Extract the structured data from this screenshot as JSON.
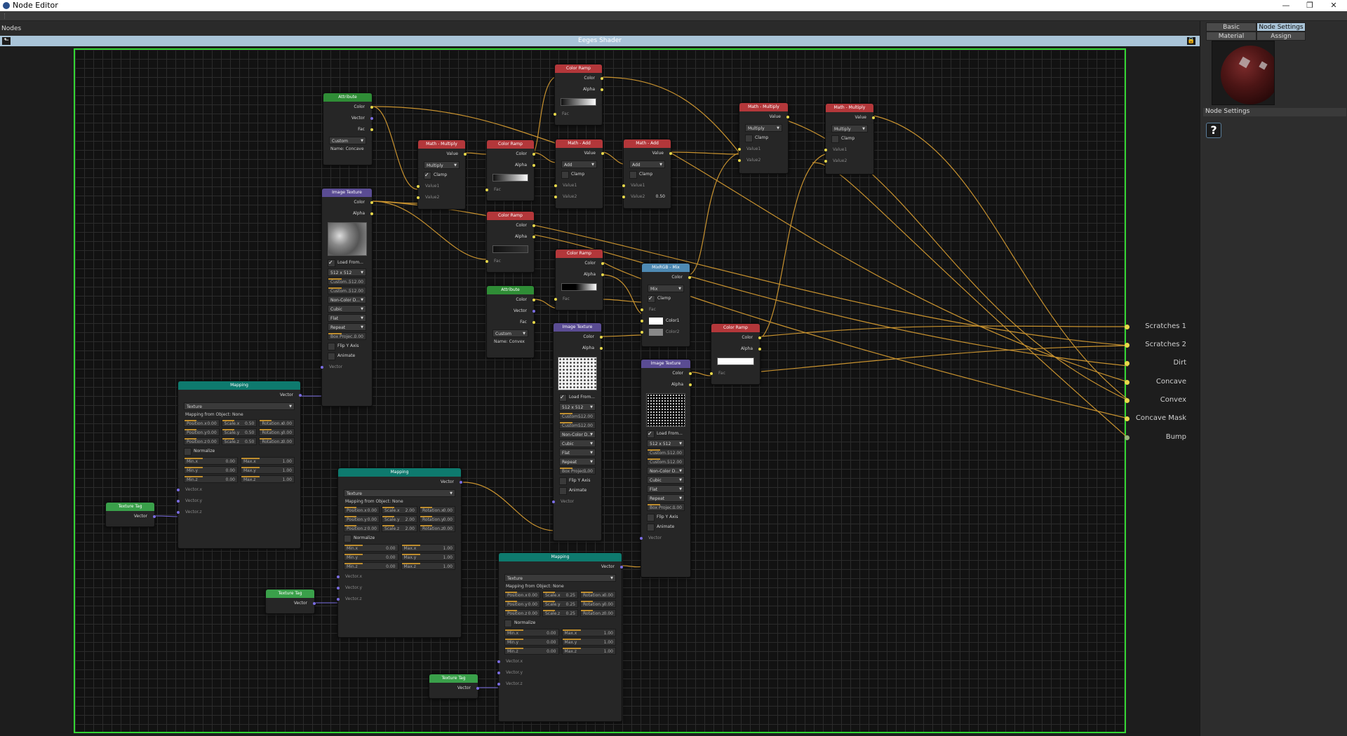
{
  "window": {
    "title": "Node Editor",
    "minimize": "—",
    "restore": "❐",
    "close": "✕"
  },
  "canvas": {
    "label": "Nodes",
    "shader_title": "Eeges Shader"
  },
  "colors": {
    "attribute": "#2f8d36",
    "color_ramp": "#b3373a",
    "math": "#b3373a",
    "image_texture": "#5a4c93",
    "mapping": "#0e7a6e",
    "texture_tag": "#3aa04a",
    "mix": "#4e8ab3",
    "output_dot": "#e7d84a",
    "wire": "#c8922f",
    "canvas_border": "#33d633"
  },
  "nodes": {
    "attr1": {
      "title": "Attribute",
      "ports": [
        "Color",
        "Vector",
        "Fac"
      ],
      "mode": "Custom",
      "name": "Name: Concave"
    },
    "attr2": {
      "title": "Attribute",
      "ports": [
        "Color",
        "Vector",
        "Fac"
      ],
      "mode": "Custom",
      "name": "Name: Convex"
    },
    "img1": {
      "title": "Image Texture",
      "color": "Color",
      "alpha": "Alpha",
      "load": "Load From...",
      "res": "512 x 512",
      "cw": "Custom...",
      "cw_v": "512.00",
      "ch": "Custom...",
      "ch_v": "512.00",
      "cs": "Non-Color D...",
      "interp": "Cubic",
      "proj": "Flat",
      "ext": "Repeat",
      "box": "Box Projec...",
      "box_v": "0.00",
      "flip": "Flip Y Axis",
      "anim": "Animate",
      "vec": "Vector"
    },
    "ramp_top": {
      "title": "Color Ramp",
      "color": "Color",
      "alpha": "Alpha",
      "fac": "Fac"
    },
    "ramp_a": {
      "title": "Color Ramp",
      "color": "Color",
      "alpha": "Alpha",
      "fac": "Fac"
    },
    "ramp_b": {
      "title": "Color Ramp",
      "color": "Color",
      "alpha": "Alpha",
      "fac": "Fac"
    },
    "ramp_c": {
      "title": "Color Ramp",
      "color": "Color",
      "alpha": "Alpha",
      "fac": "Fac"
    },
    "ramp_d": {
      "title": "Color Ramp",
      "color": "Color",
      "alpha": "Alpha",
      "fac": "Fac"
    },
    "mult1": {
      "title": "Math - Multiply",
      "value": "Value",
      "mode": "Multiply",
      "clamp": "Clamp",
      "v1": "Value1",
      "v2": "Value2"
    },
    "add1": {
      "title": "Math - Add",
      "value": "Value",
      "mode": "Add",
      "clamp": "Clamp",
      "v1": "Value1",
      "v2": "Value2"
    },
    "add2": {
      "title": "Math - Add",
      "value": "Value",
      "mode": "Add",
      "clamp": "Clamp",
      "v1": "Value1",
      "v2": "Value2",
      "v2_val": "0.50"
    },
    "mult2": {
      "title": "Math - Multiply",
      "value": "Value",
      "mode": "Multiply",
      "clamp": "Clamp",
      "v1": "Value1",
      "v2": "Value2"
    },
    "mult3": {
      "title": "Math - Multiply",
      "value": "Value",
      "mode": "Multiply",
      "clamp": "Clamp",
      "v1": "Value1",
      "v2": "Value2"
    },
    "mix": {
      "title": "MixRGB - Mix",
      "color": "Color",
      "mode": "Mix",
      "clamp": "Clamp",
      "fac": "Fac",
      "c1": "Color1",
      "c2": "Color2"
    },
    "img2": {
      "title": "Image Texture",
      "color": "Color",
      "alpha": "Alpha",
      "load": "Load From...",
      "res": "512 x 512",
      "cw": "Custom...",
      "cw_v": "512.00",
      "ch": "Custom...",
      "ch_v": "512.00",
      "cs": "Non-Color D...",
      "interp": "Cubic",
      "proj": "Flat",
      "ext": "Repeat",
      "box": "Box Projec...",
      "box_v": "0.00",
      "flip": "Flip Y Axis",
      "anim": "Animate",
      "vec": "Vector"
    },
    "img3": {
      "title": "Image Texture",
      "color": "Color",
      "alpha": "Alpha",
      "load": "Load From...",
      "res": "512 x 512",
      "cw": "Custom...",
      "cw_v": "512.00",
      "ch": "Custom...",
      "ch_v": "512.00",
      "cs": "Non-Color D...",
      "interp": "Cubic",
      "proj": "Flat",
      "ext": "Repeat",
      "box": "Box Projec...",
      "box_v": "0.00",
      "flip": "Flip Y Axis",
      "anim": "Animate",
      "vec": "Vector"
    },
    "map1": {
      "title": "Mapping",
      "vector": "Vector",
      "mode": "Texture",
      "from": "Mapping from Object: None",
      "px": "Position.x",
      "py": "Position.y",
      "pz": "Position.z",
      "sx": "Scale.x",
      "sy": "Scale.y",
      "sz": "Scale.z",
      "rx": "Rotation.x",
      "ry": "Rotation.y",
      "rz": "Rotation.z",
      "pv": "0.00",
      "sv": "0.50",
      "rv": "0.00",
      "norm": "Normalize",
      "minx": "Min.x",
      "miny": "Min.y",
      "minz": "Min.z",
      "maxx": "Max.x",
      "maxy": "Max.y",
      "maxz": "Max.z",
      "minv": "0.00",
      "maxv": "1.00",
      "vx": "Vector.x",
      "vy": "Vector.y",
      "vz": "Vector.z"
    },
    "map2": {
      "title": "Mapping",
      "vector": "Vector",
      "mode": "Texture",
      "from": "Mapping from Object: None",
      "px": "Position.x",
      "py": "Position.y",
      "pz": "Position.z",
      "sx": "Scale.x",
      "sy": "Scale.y",
      "sz": "Scale.z",
      "rx": "Rotation.x",
      "ry": "Rotation.y",
      "rz": "Rotation.z",
      "pv": "0.00",
      "sv": "2.00",
      "rv": "0.00",
      "norm": "Normalize",
      "minx": "Min.x",
      "miny": "Min.y",
      "minz": "Min.z",
      "maxx": "Max.x",
      "maxy": "Max.y",
      "maxz": "Max.z",
      "minv": "0.00",
      "maxv": "1.00",
      "vx": "Vector.x",
      "vy": "Vector.y",
      "vz": "Vector.z"
    },
    "map3": {
      "title": "Mapping",
      "vector": "Vector",
      "mode": "Texture",
      "from": "Mapping from Object: None",
      "px": "Position.x",
      "py": "Position.y",
      "pz": "Position.z",
      "sx": "Scale.x",
      "sy": "Scale.y",
      "sz": "Scale.z",
      "rx": "Rotation.x",
      "ry": "Rotation.y",
      "rz": "Rotation.z",
      "pv": "0.00",
      "sv": "0.25",
      "rv": "0.00",
      "norm": "Normalize",
      "minx": "Min.x",
      "miny": "Min.y",
      "minz": "Min.z",
      "maxx": "Max.x",
      "maxy": "Max.y",
      "maxz": "Max.z",
      "minv": "0.00",
      "maxv": "1.00",
      "vx": "Vector.x",
      "vy": "Vector.y",
      "vz": "Vector.z"
    },
    "tag1": {
      "title": "Texture Tag",
      "vector": "Vector"
    },
    "tag2": {
      "title": "Texture Tag",
      "vector": "Vector"
    },
    "tag3": {
      "title": "Texture Tag",
      "vector": "Vector"
    }
  },
  "outputs": [
    "Scratches 1",
    "Scratches 2",
    "Dirt",
    "Concave",
    "Convex",
    "Concave Mask",
    "Bump"
  ],
  "right_panel": {
    "tabs": [
      "Basic",
      "Node Settings",
      "Material Settings",
      "Assign"
    ],
    "section": "Node Settings",
    "help": "?"
  }
}
